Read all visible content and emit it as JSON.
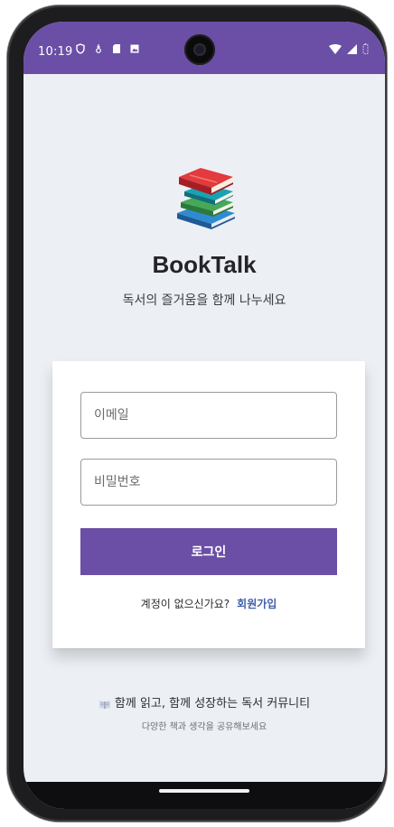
{
  "status_bar": {
    "time": "10:19",
    "background": "#6b4fa6"
  },
  "app": {
    "logo_icon": "books-stack-icon",
    "title": "BookTalk",
    "subtitle": "독서의 즐거움을 함께 나누세요"
  },
  "login_form": {
    "email_placeholder": "이메일",
    "password_placeholder": "비밀번호",
    "login_button": "로그인",
    "signup_prompt": "계정이 없으신가요?",
    "signup_link": "회원가입",
    "accent_color": "#6b4fa6",
    "link_color": "#3f5ea8"
  },
  "footer": {
    "line1": "함께 읽고, 함께 성장하는 독서 커뮤니티",
    "line1_icon": "open-book-icon",
    "line2": "다양한 책과 생각을 공유해보세요"
  }
}
